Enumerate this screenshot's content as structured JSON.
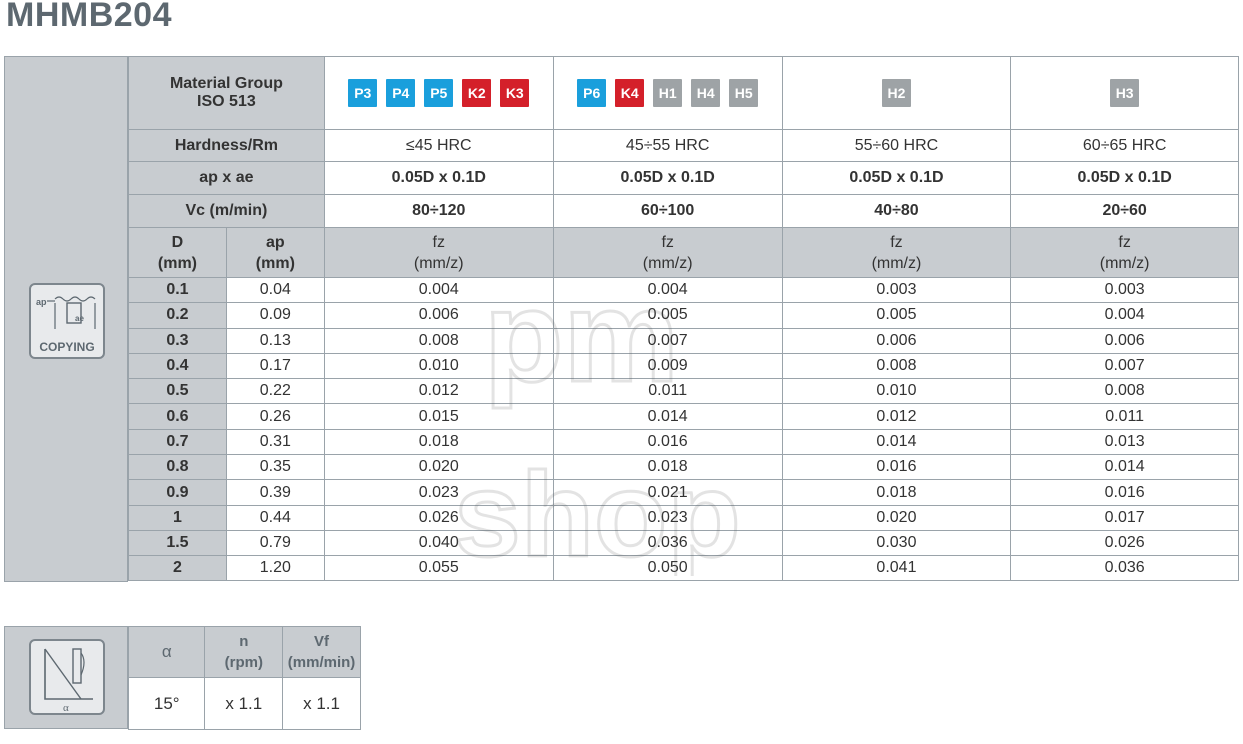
{
  "title": "MHMB204",
  "header": {
    "material_group_label": "Material Group",
    "iso_label": "ISO 513",
    "hardness_label": "Hardness/Rm",
    "apae_label": "ap x ae",
    "vc_label": "Vc (m/min)",
    "groups": [
      {
        "badges": [
          {
            "text": "P3",
            "kind": "p"
          },
          {
            "text": "P4",
            "kind": "p"
          },
          {
            "text": "P5",
            "kind": "p"
          },
          {
            "text": "K2",
            "kind": "k"
          },
          {
            "text": "K3",
            "kind": "k"
          }
        ],
        "hardness": "≤45 HRC",
        "apae": "0.05D x 0.1D",
        "vc": "80÷120"
      },
      {
        "badges": [
          {
            "text": "P6",
            "kind": "p"
          },
          {
            "text": "K4",
            "kind": "k"
          },
          {
            "text": "H1",
            "kind": "h"
          },
          {
            "text": "H4",
            "kind": "h"
          },
          {
            "text": "H5",
            "kind": "h"
          }
        ],
        "hardness": "45÷55 HRC",
        "apae": "0.05D x 0.1D",
        "vc": "60÷100"
      },
      {
        "badges": [
          {
            "text": "H2",
            "kind": "h"
          }
        ],
        "hardness": "55÷60 HRC",
        "apae": "0.05D x 0.1D",
        "vc": "40÷80"
      },
      {
        "badges": [
          {
            "text": "H3",
            "kind": "h"
          }
        ],
        "hardness": "60÷65 HRC",
        "apae": "0.05D x 0.1D",
        "vc": "20÷60"
      }
    ],
    "col_d": "D",
    "col_d_unit": "(mm)",
    "col_ap": "ap",
    "col_ap_unit": "(mm)",
    "col_fz": "fz",
    "col_fz_unit": "(mm/z)"
  },
  "icon": {
    "label": "COPYING",
    "ap_text": "ap",
    "ae_text": "ae"
  },
  "rows": [
    {
      "d": "0.1",
      "ap": "0.04",
      "fz": [
        "0.004",
        "0.004",
        "0.003",
        "0.003"
      ]
    },
    {
      "d": "0.2",
      "ap": "0.09",
      "fz": [
        "0.006",
        "0.005",
        "0.005",
        "0.004"
      ]
    },
    {
      "d": "0.3",
      "ap": "0.13",
      "fz": [
        "0.008",
        "0.007",
        "0.006",
        "0.006"
      ]
    },
    {
      "d": "0.4",
      "ap": "0.17",
      "fz": [
        "0.010",
        "0.009",
        "0.008",
        "0.007"
      ]
    },
    {
      "d": "0.5",
      "ap": "0.22",
      "fz": [
        "0.012",
        "0.011",
        "0.010",
        "0.008"
      ]
    },
    {
      "d": "0.6",
      "ap": "0.26",
      "fz": [
        "0.015",
        "0.014",
        "0.012",
        "0.011"
      ]
    },
    {
      "d": "0.7",
      "ap": "0.31",
      "fz": [
        "0.018",
        "0.016",
        "0.014",
        "0.013"
      ]
    },
    {
      "d": "0.8",
      "ap": "0.35",
      "fz": [
        "0.020",
        "0.018",
        "0.016",
        "0.014"
      ]
    },
    {
      "d": "0.9",
      "ap": "0.39",
      "fz": [
        "0.023",
        "0.021",
        "0.018",
        "0.016"
      ]
    },
    {
      "d": "1",
      "ap": "0.44",
      "fz": [
        "0.026",
        "0.023",
        "0.020",
        "0.017"
      ]
    },
    {
      "d": "1.5",
      "ap": "0.79",
      "fz": [
        "0.040",
        "0.036",
        "0.030",
        "0.026"
      ]
    },
    {
      "d": "2",
      "ap": "1.20",
      "fz": [
        "0.055",
        "0.050",
        "0.041",
        "0.036"
      ]
    }
  ],
  "ramp": {
    "icon_alpha": "α",
    "alpha_header": "α",
    "n_header": "n",
    "n_unit": "(rpm)",
    "vf_header": "Vf",
    "vf_unit": "(mm/min)",
    "alpha_value": "15°",
    "n_value": "x 1.1",
    "vf_value": "x 1.1"
  },
  "watermark": {
    "line1": "pm",
    "line2": "shop"
  },
  "colors": {
    "p_badge": "#1a9fdc",
    "k_badge": "#d4202a",
    "h_badge": "#9ea3a6",
    "header_bg": "#c8ccd0"
  }
}
